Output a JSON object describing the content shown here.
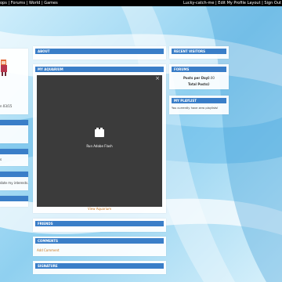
{
  "topbar": {
    "left_text": "ops | Forums | World | Games",
    "right_text": "Lucky-catch-me | Edit My Profile Layout | Sign Out"
  },
  "left_column": {
    "date_text": "n 03/15",
    "snippet_1": "s",
    "snippet_2": "date my interests."
  },
  "center_column": {
    "about_header": "ABOUT",
    "aquarium_header": "MY AQUARIUM",
    "flash_label": "Run Adobe Flash",
    "close_symbol": "×",
    "view_aquarium_link": "View Aquarium",
    "friends_header": "FRIENDS",
    "comments_header": "COMMENTS",
    "add_comment_link": "Add Comment",
    "signature_header": "SIGNATURE"
  },
  "right_column": {
    "recent_visitors_header": "RECENT VISITORS",
    "forums_header": "FORUMS",
    "posts_per_day_label": "Posts per Day:",
    "posts_per_day_value": "0.00",
    "total_posts_label": "Total Posts:",
    "total_posts_value": "0",
    "playlist_header": "MY PLAYLIST",
    "playlist_text": "You currently have zero playlists!"
  },
  "colors": {
    "header_blue": "#3a7ec8",
    "link_orange": "#c8731a",
    "flash_dark": "#3b3b3b"
  },
  "icons": [
    "lego-block-icon",
    "close-icon",
    "avatar-sprite"
  ]
}
